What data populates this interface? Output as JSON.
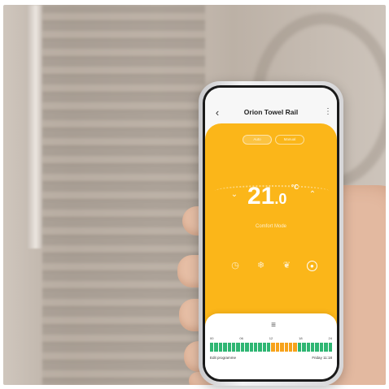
{
  "app": {
    "title": "Orion Towel Rail",
    "back_icon": "chevron-left-icon",
    "more_icon": "more-vertical-icon"
  },
  "mode_toggle": {
    "options": [
      "Auto",
      "Manual"
    ],
    "selected": "Auto"
  },
  "thermostat": {
    "temp_int": "21",
    "temp_dec": ".0",
    "unit": "°C",
    "mode_label": "Comfort Mode",
    "decrease_icon": "chevron-down-icon",
    "increase_icon": "chevron-up-icon"
  },
  "mode_icons": [
    {
      "name": "timer-icon",
      "glyph": "◷"
    },
    {
      "name": "snowflake-icon",
      "glyph": "❄"
    },
    {
      "name": "leaf-icon",
      "glyph": "❦"
    },
    {
      "name": "comfort-icon",
      "glyph": "●"
    }
  ],
  "schedule": {
    "handle_icon": "menu-icon",
    "hours": [
      "00",
      "06",
      "12",
      "18",
      "24"
    ],
    "blocks": [
      "green",
      "green",
      "green",
      "green",
      "green",
      "green",
      "green",
      "green",
      "green",
      "green",
      "green",
      "green",
      "green",
      "green",
      "orange",
      "orange",
      "orange",
      "orange",
      "orange",
      "orange",
      "green",
      "green",
      "green",
      "green",
      "green",
      "green",
      "green",
      "green"
    ],
    "left_note": "Edit programme",
    "right_note": "Friday 11:18"
  },
  "colors": {
    "accent": "#fbb619",
    "green": "#2fb673",
    "orange": "#f7a21b"
  }
}
